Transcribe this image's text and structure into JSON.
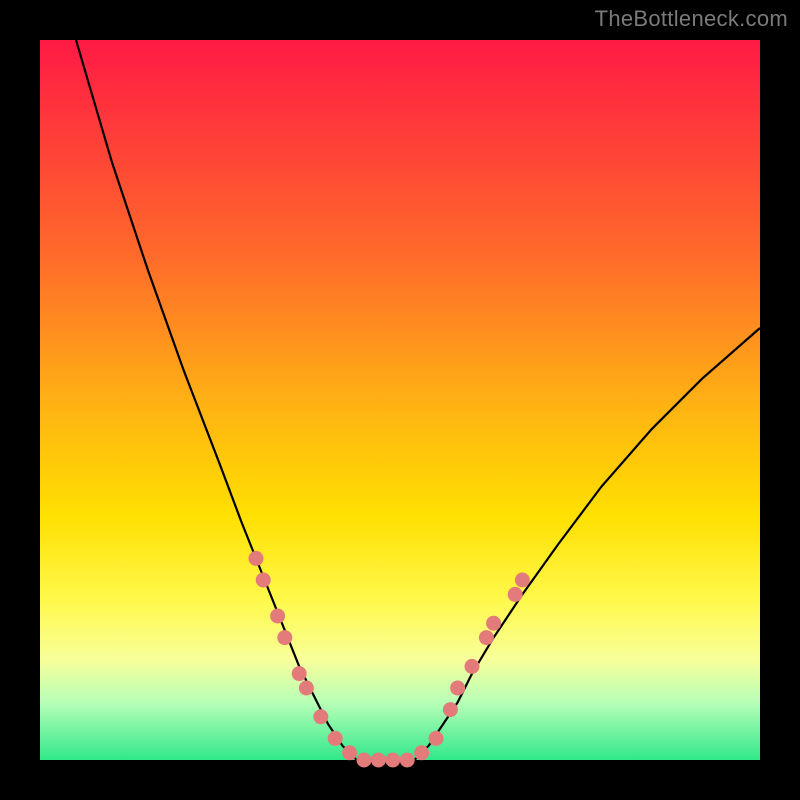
{
  "watermark_text": "TheBottleneck.com",
  "chart_data": {
    "type": "line",
    "title": "",
    "xlabel": "",
    "ylabel": "",
    "xlim": [
      0,
      100
    ],
    "ylim": [
      0,
      100
    ],
    "grid": false,
    "legend": false,
    "background": "rainbow-vertical (red top → green bottom)",
    "series": [
      {
        "name": "left-curve",
        "x": [
          5,
          10,
          15,
          20,
          25,
          28,
          30,
          32,
          34,
          36,
          38,
          40,
          42,
          44
        ],
        "y": [
          100,
          83,
          68,
          54,
          41,
          33,
          28,
          23,
          18,
          13,
          9,
          5,
          2,
          0
        ]
      },
      {
        "name": "bottom-flat",
        "x": [
          44,
          46,
          48,
          50,
          52
        ],
        "y": [
          0,
          0,
          0,
          0,
          0
        ]
      },
      {
        "name": "right-curve",
        "x": [
          52,
          54,
          56,
          58,
          60,
          63,
          67,
          72,
          78,
          85,
          92,
          100
        ],
        "y": [
          0,
          2,
          5,
          8,
          12,
          17,
          23,
          30,
          38,
          46,
          53,
          60
        ]
      }
    ],
    "dots": [
      {
        "x": 30,
        "y": 28
      },
      {
        "x": 31,
        "y": 25
      },
      {
        "x": 33,
        "y": 20
      },
      {
        "x": 34,
        "y": 17
      },
      {
        "x": 36,
        "y": 12
      },
      {
        "x": 37,
        "y": 10
      },
      {
        "x": 39,
        "y": 6
      },
      {
        "x": 41,
        "y": 3
      },
      {
        "x": 43,
        "y": 1
      },
      {
        "x": 45,
        "y": 0
      },
      {
        "x": 47,
        "y": 0
      },
      {
        "x": 49,
        "y": 0
      },
      {
        "x": 51,
        "y": 0
      },
      {
        "x": 53,
        "y": 1
      },
      {
        "x": 55,
        "y": 3
      },
      {
        "x": 57,
        "y": 7
      },
      {
        "x": 58,
        "y": 10
      },
      {
        "x": 60,
        "y": 13
      },
      {
        "x": 62,
        "y": 17
      },
      {
        "x": 63,
        "y": 19
      },
      {
        "x": 66,
        "y": 23
      },
      {
        "x": 67,
        "y": 25
      }
    ],
    "dot_color": "#e47b7b",
    "curve_color": "#000000"
  }
}
